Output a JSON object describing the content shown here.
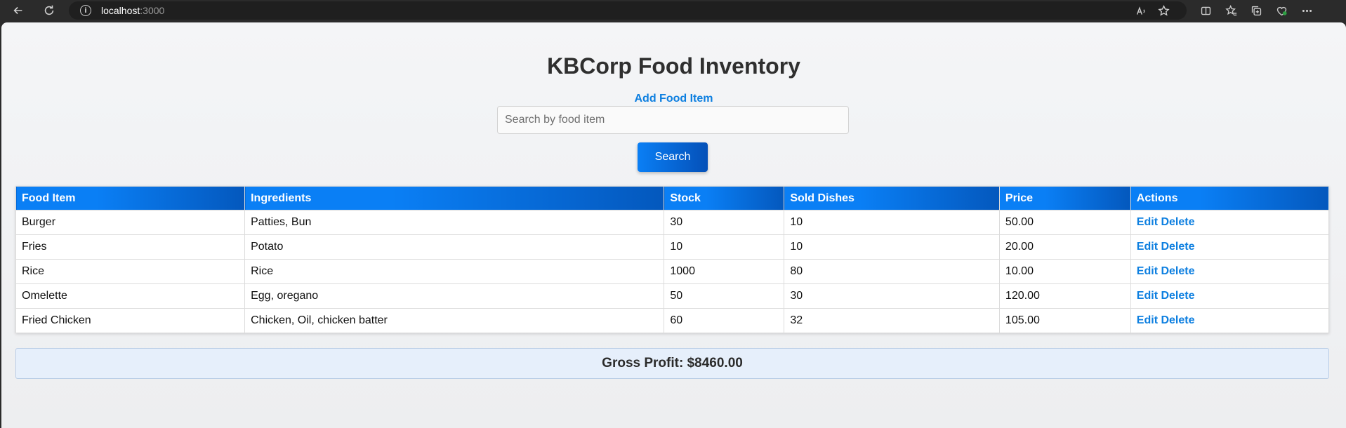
{
  "browser": {
    "url_host": "localhost",
    "url_port": ":3000",
    "icons": [
      "back-icon",
      "refresh-icon",
      "info-icon",
      "read-aloud-icon",
      "favorite-star-icon",
      "split-screen-icon",
      "favorites-icon",
      "collections-icon",
      "browser-essentials-icon",
      "more-icon"
    ]
  },
  "page": {
    "title": "KBCorp Food Inventory",
    "add_link": "Add Food Item",
    "search": {
      "placeholder": "Search by food item",
      "value": ""
    },
    "search_button": "Search"
  },
  "table": {
    "headers": [
      "Food Item",
      "Ingredients",
      "Stock",
      "Sold Dishes",
      "Price",
      "Actions"
    ],
    "rows": [
      {
        "name": "Burger",
        "ingredients": "Patties, Bun",
        "stock": "30",
        "sold": "10",
        "price": "50.00"
      },
      {
        "name": "Fries",
        "ingredients": "Potato",
        "stock": "10",
        "sold": "10",
        "price": "20.00"
      },
      {
        "name": "Rice",
        "ingredients": "Rice",
        "stock": "1000",
        "sold": "80",
        "price": "10.00"
      },
      {
        "name": "Omelette",
        "ingredients": "Egg, oregano",
        "stock": "50",
        "sold": "30",
        "price": "120.00"
      },
      {
        "name": "Fried Chicken",
        "ingredients": "Chicken, Oil, chicken batter",
        "stock": "60",
        "sold": "32",
        "price": "105.00"
      }
    ],
    "edit_label": "Edit",
    "delete_label": "Delete"
  },
  "summary": {
    "gross_profit": "Gross Profit: $8460.00"
  },
  "colors": {
    "accent": "#0a7ff5",
    "accent_dark": "#0450b8",
    "link": "#0d7fe0",
    "profit_bg": "#e6effb"
  }
}
